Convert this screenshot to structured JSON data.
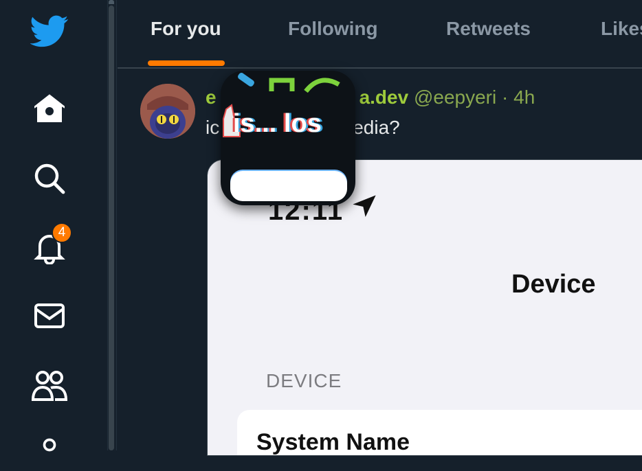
{
  "sidebar": {
    "icons": [
      "twitter-logo",
      "home-icon",
      "search-icon",
      "notifications-icon",
      "messages-icon",
      "communities-icon",
      "profile-icon"
    ],
    "notification_count": "4"
  },
  "tabs": [
    {
      "label": "For you",
      "active": true
    },
    {
      "label": "Following",
      "active": false
    },
    {
      "label": "Retweets",
      "active": false
    },
    {
      "label": "Likes",
      "active": false
    }
  ],
  "tweet": {
    "name_visible_start": "e",
    "name_visible_end": "a.dev",
    "handle": "@eepyeri",
    "time": "· 4h",
    "text_start": "ic",
    "text_end": "edia?"
  },
  "media": {
    "status_time": "12:11",
    "title": "Device",
    "section": "DEVICE",
    "row_label": "System Name"
  },
  "overlay": {
    "text": "is... los"
  },
  "colors": {
    "background": "#15202b",
    "accent": "#ff7a00",
    "name_green": "#9ecb3c"
  }
}
